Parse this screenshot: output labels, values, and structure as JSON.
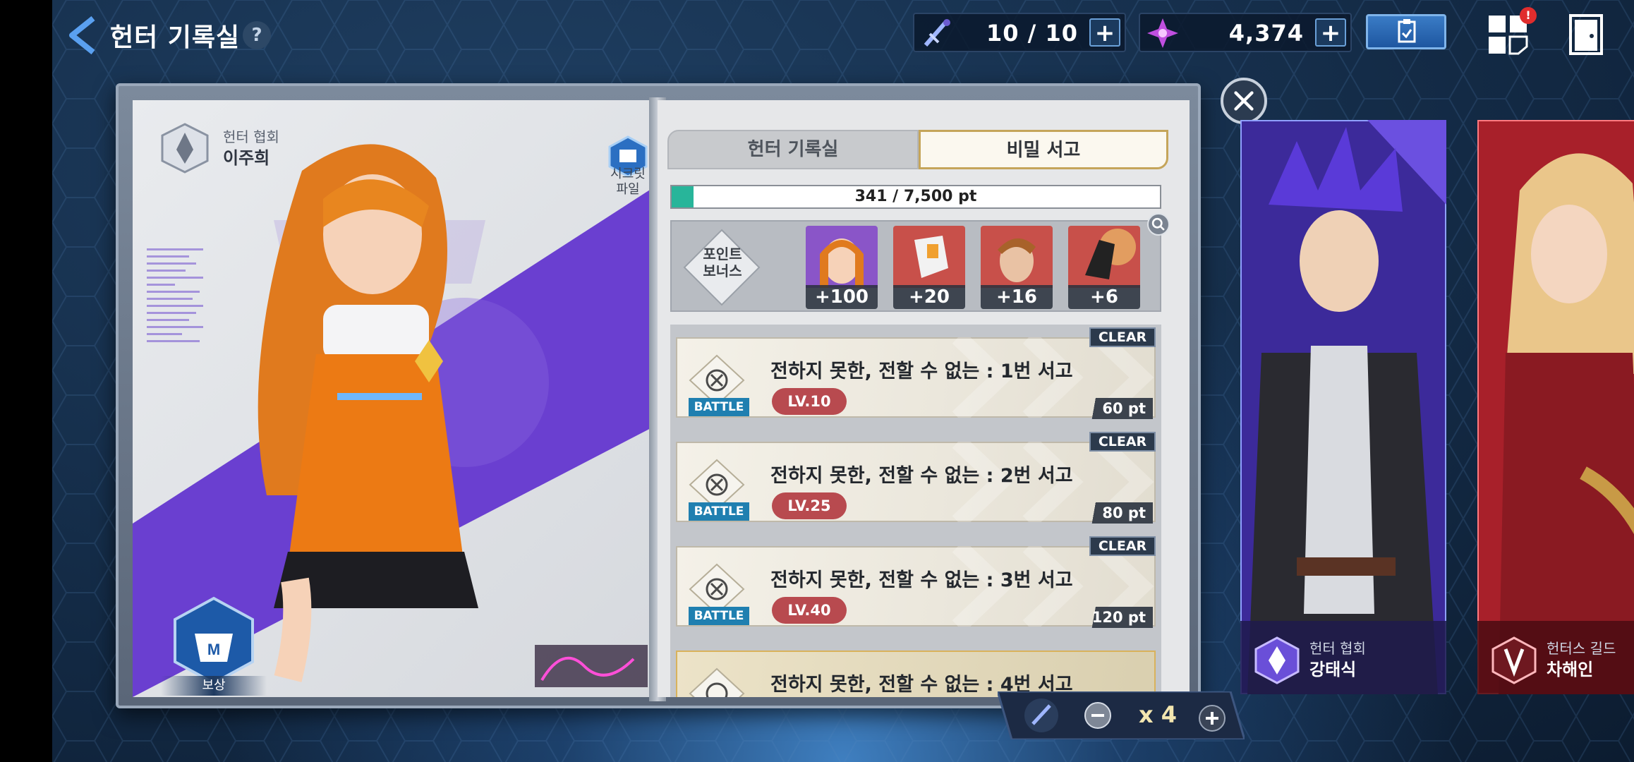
{
  "header": {
    "title": "헌터 기록실",
    "help": "?",
    "stamina": "10 / 10",
    "gems": "4,374",
    "plus": "+",
    "notification_badge": "!"
  },
  "left_page": {
    "org": "헌터 협회",
    "hunter_name": "이주희",
    "secret_file_label_1": "시크릿",
    "secret_file_label_2": "파일",
    "reward_label": "보상"
  },
  "tabs": [
    {
      "label": "헌터 기록실",
      "active": false
    },
    {
      "label": "비밀 서고",
      "active": true
    }
  ],
  "progress": {
    "text": "341 / 7,500 pt",
    "current": 341,
    "max": 7500
  },
  "bonus": {
    "label_1": "포인트",
    "label_2": "보너스",
    "items": [
      {
        "value": "+100",
        "name": "hunter-portrait-bonus"
      },
      {
        "value": "+20",
        "name": "gauntlet-bonus"
      },
      {
        "value": "+16",
        "name": "hunter-male-bonus"
      },
      {
        "value": "+6",
        "name": "glove-bonus"
      }
    ]
  },
  "quests": [
    {
      "clear": "CLEAR",
      "type": "BATTLE",
      "title": "전하지 못한, 전할 수 없는 : 1번 서고",
      "level": "LV.10",
      "points": "60 pt"
    },
    {
      "clear": "CLEAR",
      "type": "BATTLE",
      "title": "전하지 못한, 전할 수 없는 : 2번 서고",
      "level": "LV.25",
      "points": "80 pt"
    },
    {
      "clear": "CLEAR",
      "type": "BATTLE",
      "title": "전하지 못한, 전할 수 없는 : 3번 서고",
      "level": "LV.40",
      "points": "120 pt"
    },
    {
      "clear": "",
      "type": "",
      "title": "전하지 못한, 전할 수 없는 : 4번 서고",
      "level": "",
      "points": ""
    }
  ],
  "ticket": {
    "count": "x 4"
  },
  "side_cards": [
    {
      "org": "헌터 협회",
      "name": "강태식"
    },
    {
      "org": "헌터스 길드",
      "name": "차해인"
    }
  ],
  "colors": {
    "accent_teal": "#28b59a",
    "level_red": "#b84a4f",
    "battle_blue": "#1f7fb0",
    "purple": "#6a3fd0"
  }
}
